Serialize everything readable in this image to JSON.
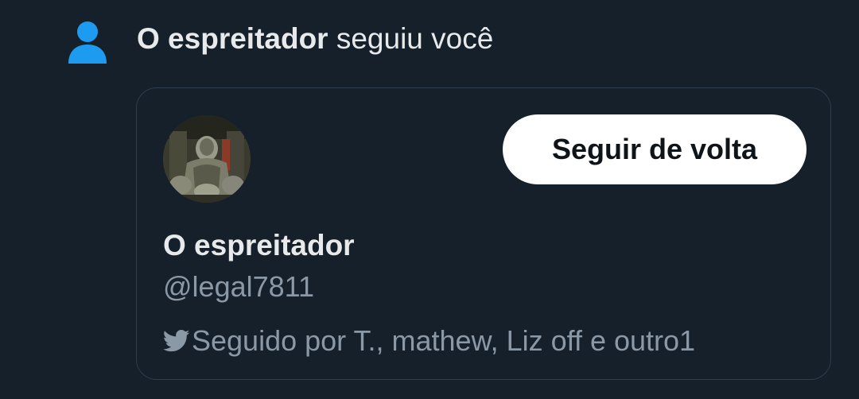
{
  "notification": {
    "icon": "person-icon",
    "actor_name": "O espreitador",
    "action_text": " seguiu você",
    "accent_color": "#1d9bf0"
  },
  "card": {
    "avatar_icon": "avatar",
    "follow_back_label": "Seguir de volta",
    "display_name": "O espreitador",
    "handle": "@legal7811",
    "followed_by_icon": "bird-icon",
    "followed_by_text": "Seguido por T., mathew, Liz off e outro1"
  },
  "colors": {
    "background": "#15202b",
    "primary_text": "#e7e9ea",
    "secondary_text": "#8b98a5",
    "button_bg": "#ffffff",
    "button_text": "#0f1419",
    "card_border": "#2f3d4c"
  }
}
